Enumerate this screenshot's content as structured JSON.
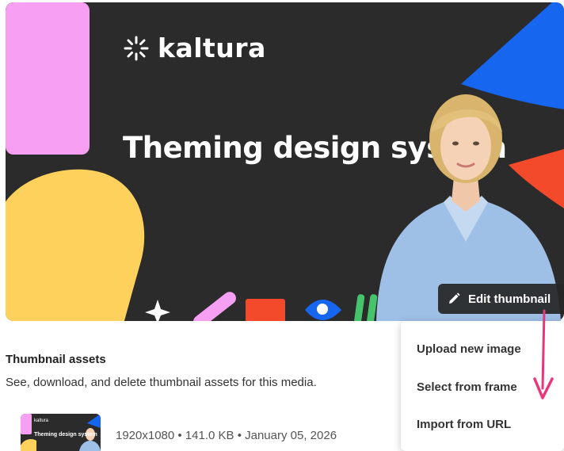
{
  "brand": {
    "name": "kaltura",
    "icon": "kaltura-asterisk-icon"
  },
  "hero": {
    "title": "Theming design system"
  },
  "edit_button": {
    "label": "Edit thumbnail",
    "icon": "pencil-icon"
  },
  "section": {
    "title": "Thumbnail assets",
    "description": "See, download, and delete thumbnail assets for this media."
  },
  "asset": {
    "brand": "kaltura",
    "title": "Theming design system",
    "meta": "1920x1080 • 141.0 KB • January 05, 2026"
  },
  "menu": {
    "items": [
      {
        "label": "Upload new image"
      },
      {
        "label": "Select from frame"
      },
      {
        "label": "Import from URL"
      }
    ]
  },
  "colors": {
    "hero_bg": "#2b2b2b",
    "pink": "#f79ff2",
    "yellow": "#fdd15c",
    "blue": "#1766f0",
    "red": "#f24a2a",
    "green": "#46c46c",
    "arrow": "#e8367c"
  }
}
